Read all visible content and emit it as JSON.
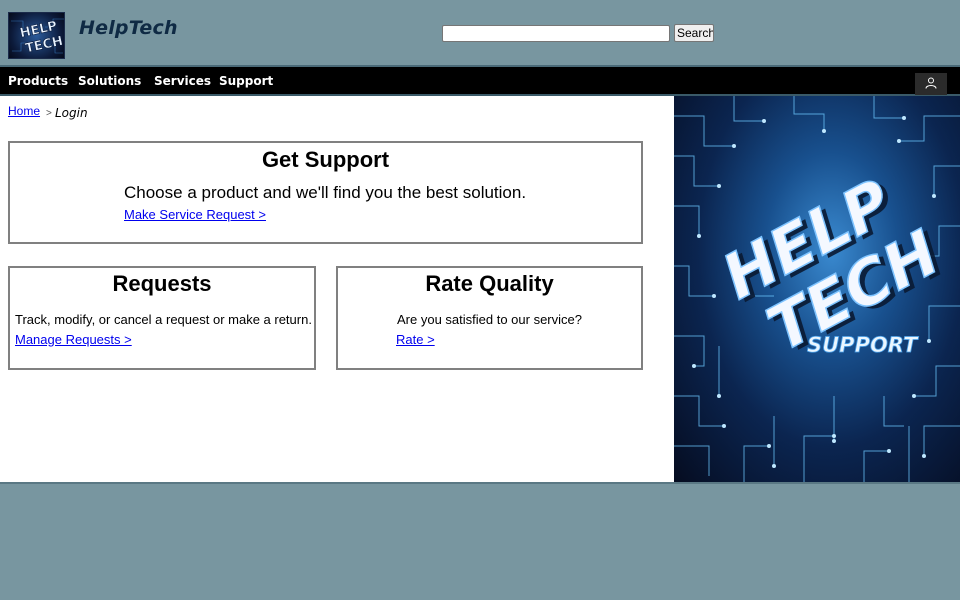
{
  "header": {
    "logo_text": "HelpTech",
    "logo_alt_lines": [
      "HELP",
      "TECH"
    ],
    "search": {
      "value": "",
      "placeholder": "",
      "button_label": "Search"
    }
  },
  "nav": {
    "items": [
      {
        "label": "Products"
      },
      {
        "label": "Solutions"
      },
      {
        "label": "Services"
      },
      {
        "label": "Support"
      }
    ],
    "user_icon": "user-icon"
  },
  "breadcrumb": {
    "home": "Home",
    "separator": ">",
    "current": "Login"
  },
  "get_support": {
    "title": "Get Support",
    "text": "Choose a product and we'll find you the best solution.",
    "link": "Make Service Request >"
  },
  "requests": {
    "title": "Requests",
    "text": "Track, modify, or cancel a request or make a return.",
    "link": "Manage Requests >"
  },
  "rate_quality": {
    "title": "Rate Quality",
    "text": "Are you satisfied to our service?",
    "link": "Rate >"
  },
  "hero": {
    "line1": "HELP",
    "line2": "TECH",
    "line3": "SUPPORT"
  },
  "colors": {
    "page_bg": "#7896a0",
    "navbar_bg": "#000000",
    "link": "#0000ee",
    "logo_text": "#0f2a44",
    "card_border": "#808080"
  }
}
